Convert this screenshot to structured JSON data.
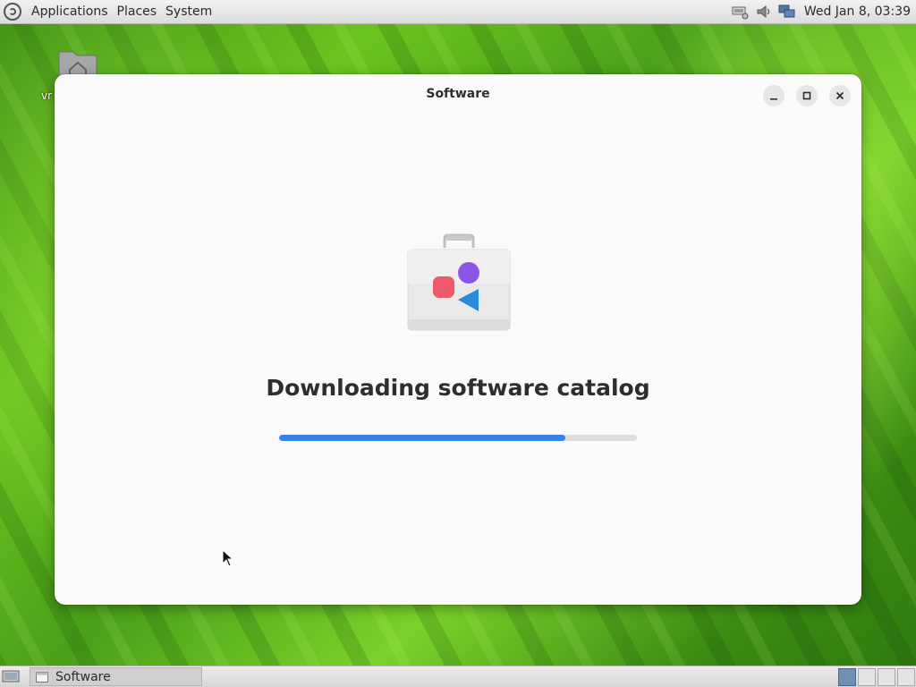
{
  "top_panel": {
    "menus": [
      "Applications",
      "Places",
      "System"
    ],
    "clock": "Wed Jan 8, 03:39",
    "tray_icons": [
      "network-device-icon",
      "volume-icon",
      "network-connection-icon"
    ]
  },
  "desktop": {
    "icon_label": "vr"
  },
  "window": {
    "title": "Software",
    "heading": "Downloading software catalog",
    "progress_percent": 80,
    "colors": {
      "accent": "#3584e4",
      "background": "#fafafa"
    }
  },
  "taskbar": {
    "task_label": "Software"
  }
}
